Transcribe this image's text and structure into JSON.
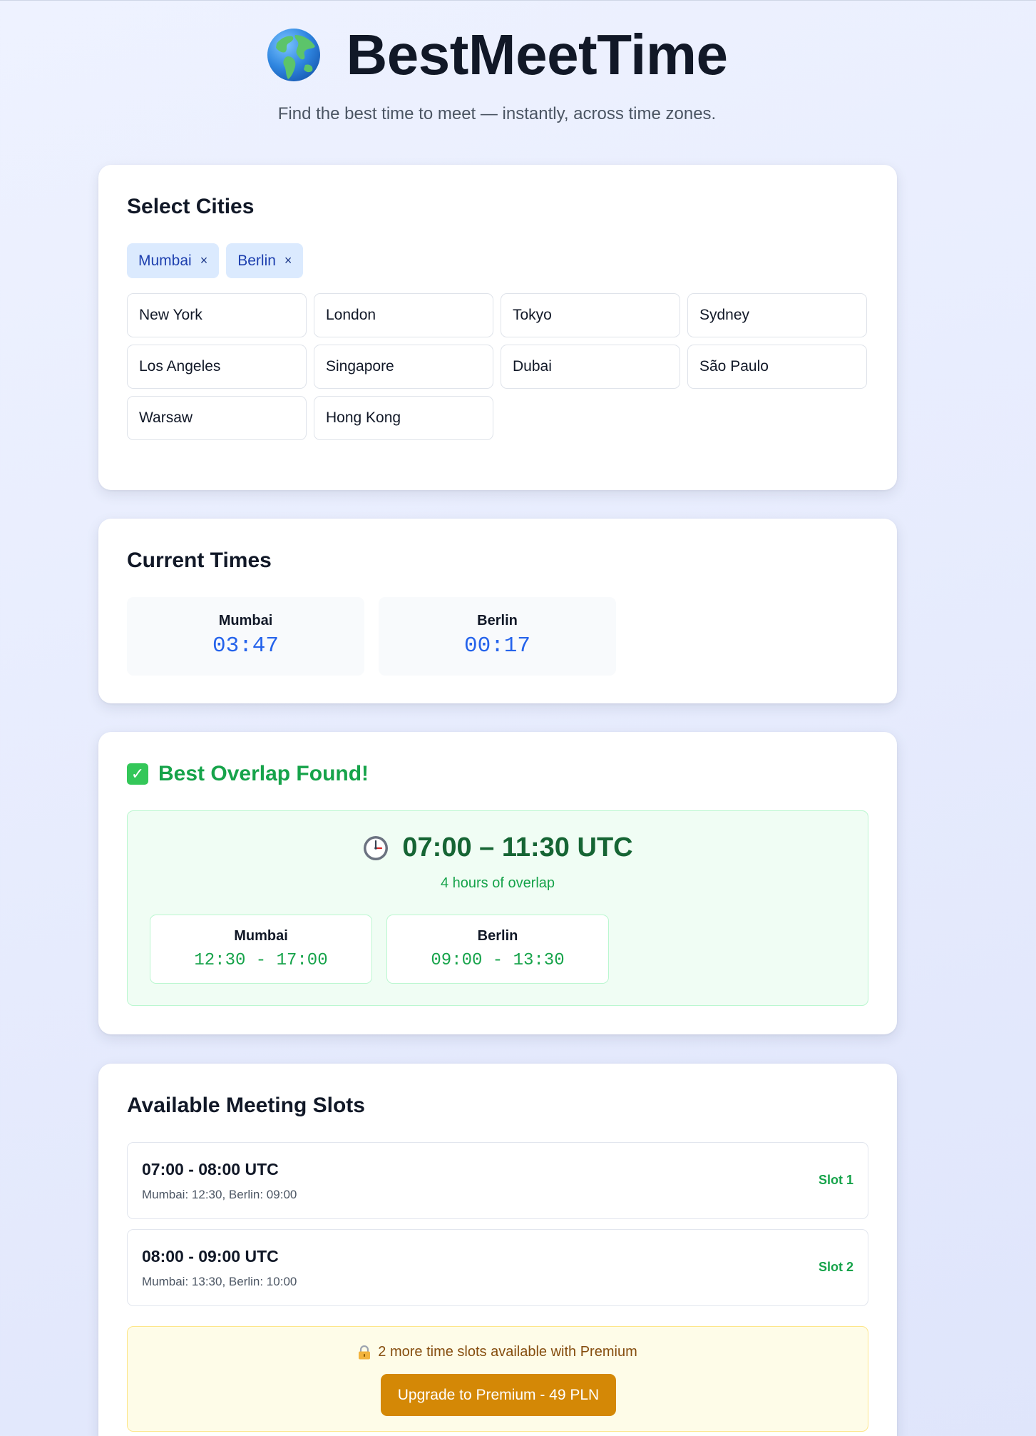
{
  "header": {
    "title": "BestMeetTime",
    "tagline": "Find the best time to meet — instantly, across time zones.",
    "icon": "globe-icon"
  },
  "select_cities": {
    "title": "Select Cities",
    "selected": [
      {
        "label": "Mumbai",
        "remove": "×"
      },
      {
        "label": "Berlin",
        "remove": "×"
      }
    ],
    "options": [
      "New York",
      "London",
      "Tokyo",
      "Sydney",
      "Los Angeles",
      "Singapore",
      "Dubai",
      "São Paulo",
      "Warsaw",
      "Hong Kong"
    ]
  },
  "current_times": {
    "title": "Current Times",
    "items": [
      {
        "city": "Mumbai",
        "time": "03:47"
      },
      {
        "city": "Berlin",
        "time": "00:17"
      }
    ]
  },
  "best_overlap": {
    "title": "Best Overlap Found!",
    "icon": "check-icon",
    "range": "07:00 – 11:30 UTC",
    "range_icon": "clock-icon",
    "hours": "4 hours of overlap",
    "local": [
      {
        "city": "Mumbai",
        "range": "12:30 - 17:00"
      },
      {
        "city": "Berlin",
        "range": "09:00 - 13:30"
      }
    ]
  },
  "slots": {
    "title": "Available Meeting Slots",
    "items": [
      {
        "time": "07:00 - 08:00 UTC",
        "local": "Mumbai: 12:30, Berlin: 09:00",
        "label": "Slot 1"
      },
      {
        "time": "08:00 - 09:00 UTC",
        "local": "Mumbai: 13:30, Berlin: 10:00",
        "label": "Slot 2"
      }
    ],
    "premium_note": "2 more time slots available with Premium",
    "premium_icon": "lock-icon",
    "upgrade_label": "Upgrade to Premium - 49 PLN"
  },
  "colors": {
    "accent_blue": "#2563eb",
    "success_green": "#16a34a",
    "premium_orange": "#d48806"
  }
}
